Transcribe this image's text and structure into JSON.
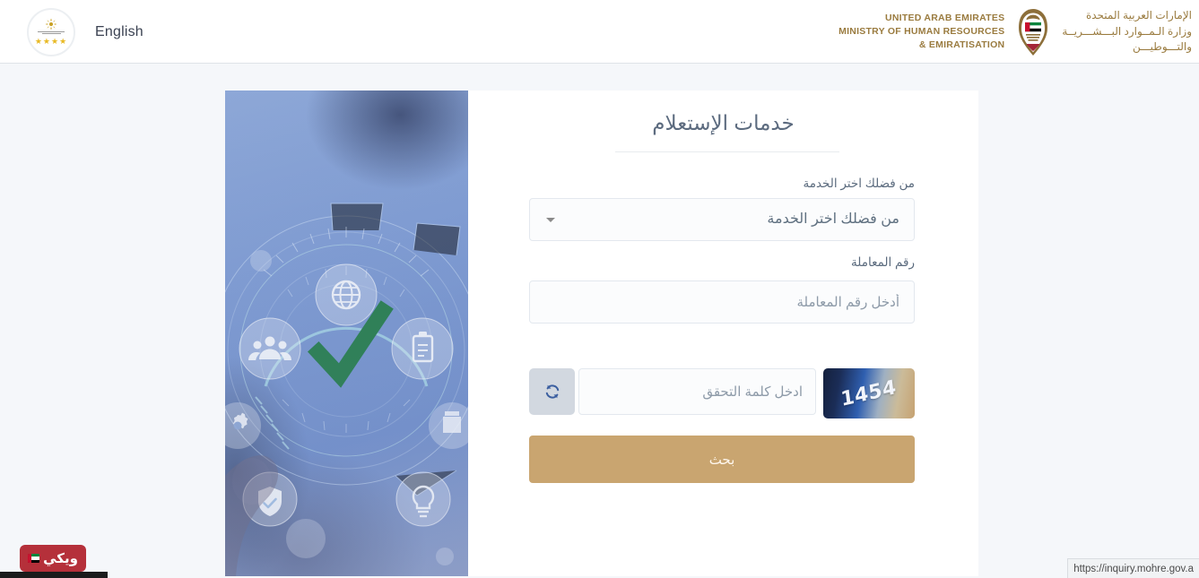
{
  "header": {
    "language_label": "English",
    "logo_icon": "uae-government-badge-icon",
    "stars": "★★★★",
    "ministry": {
      "en_line1": "UNITED ARAB EMIRATES",
      "en_line2": "MINISTRY OF HUMAN RESOURCES",
      "en_line3": "& EMIRATISATION",
      "ar_line1": "الإمارات العربية المتحدة",
      "ar_line2": "وزارة الـمــوارد البـــشـــريــة",
      "ar_line3": "والتـــوطيـــن",
      "emblem_icon": "uae-falcon-emblem-icon",
      "brand_color": "#9a7b3f"
    }
  },
  "form": {
    "title": "خدمات الإستعلام",
    "service": {
      "label": "من فضلك اختر الخدمة",
      "selected_value": "من فضلك اختر الخدمة",
      "caret_icon": "chevron-down-icon"
    },
    "transaction": {
      "label": "رقم المعاملة",
      "placeholder": "أدخل رقم المعاملة",
      "value": ""
    },
    "captcha": {
      "code": "1454",
      "placeholder": "ادخل كلمة التحقق",
      "value": "",
      "refresh_icon": "refresh-icon"
    },
    "submit_label": "بحث",
    "submit_color": "#c9a570"
  },
  "hero": {
    "icons": [
      "globe-icon",
      "clipboard-icon",
      "people-icon",
      "gear-icon",
      "shield-check-icon",
      "lightbulb-icon",
      "building-icon"
    ],
    "check_icon": "green-checkmark-icon",
    "check_color": "#1f7a42"
  },
  "overlays": {
    "watermark": {
      "text": "ويكي",
      "flag_icon": "uae-flag-icon",
      "background": "#b5303a"
    },
    "status_bar_url": "https://inquiry.mohre.gov.a"
  }
}
